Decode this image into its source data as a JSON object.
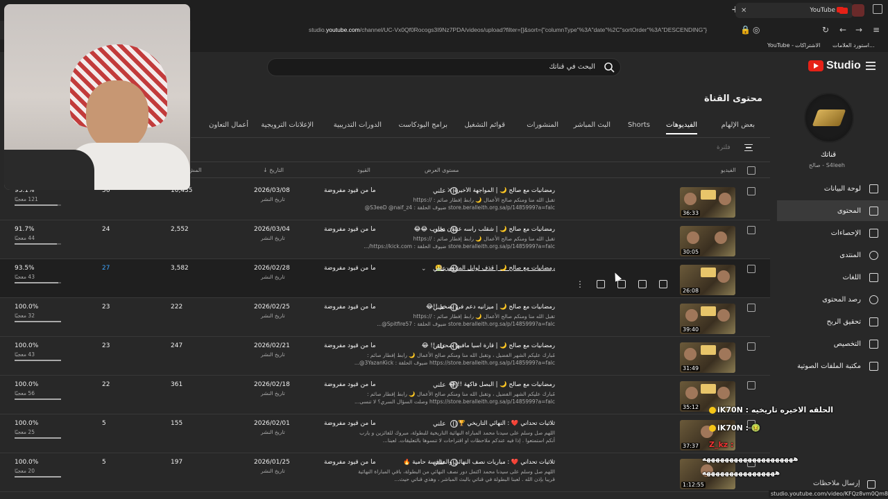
{
  "browser": {
    "tab_title": "YouTube",
    "url_prefix": "studio.",
    "url_domain": "youtube.com",
    "url_rest": "/channel/UC-Vx0Qf0Rocogs3I9Nz7PDA/videos/upload?filter=[]&sort={\"columnType\"%3A\"date\"%2C\"sortOrder\"%3A\"DESCENDING\"}",
    "bookmarks": [
      "استورد العلامات...",
      "الاشتراكات",
      "YouTube -"
    ]
  },
  "header": {
    "search_placeholder": "البحث في قناتك",
    "logo_text": "Studio"
  },
  "channel": {
    "name": "قناتك",
    "handle": "S4leeh - صالح"
  },
  "sidebar": {
    "items": [
      {
        "label": "لوحة البيانات",
        "icon": "dashboard-icon"
      },
      {
        "label": "المحتوى",
        "icon": "content-icon"
      },
      {
        "label": "الإحصاءات",
        "icon": "analytics-icon"
      },
      {
        "label": "المنتدى",
        "icon": "community-icon"
      },
      {
        "label": "اللغات",
        "icon": "subtitles-icon"
      },
      {
        "label": "رصد المحتوى",
        "icon": "copyright-icon"
      },
      {
        "label": "تحقيق الربح",
        "icon": "earn-icon"
      },
      {
        "label": "التخصيص",
        "icon": "customization-icon"
      },
      {
        "label": "مكتبة الملفات الصوتية",
        "icon": "audio-library-icon"
      }
    ],
    "feedback": "إرسال ملاحظات"
  },
  "main": {
    "title": "محتوى القناة",
    "tabs": [
      "بعض الإلهام",
      "الفيديوهات",
      "Shorts",
      "البث المباشر",
      "المنشورات",
      "قوائم التشغيل",
      "برامج البودكاست",
      "الدورات التدريبية",
      "الإعلانات الترويجية",
      "أعمال التعاون"
    ],
    "filter_label": "فلترة",
    "columns": {
      "video": "الفيديو",
      "visibility": "مستوى العرض",
      "restrictions": "القيود",
      "date": "التاريخ",
      "views": "المش"
    },
    "rows": [
      {
        "title": "رمضانيات مع صالح 🌙 | المواجهة الأخيرة ⚔",
        "desc": "تقبل الله منا ومنكم صالح الأعمال 🌙 رابط إفطار صائم : https:// store.beralleith.org.sa/p/1485999?a=falc ضيوف الحلقة : S3eeD @naif_z4@",
        "duration": "36:33",
        "visibility": "علني",
        "restrictions": "ما من قيود مفروضة",
        "date": "2026/03/08",
        "date_label": "تاريخ النشر",
        "views": "10,435",
        "comments": "56",
        "like_pct": "93.1%",
        "likes": "121 معجبًا",
        "like_ratio": 0.931
      },
      {
        "title": "رمضانيات مع صالح 🌙 | شقلب راسه عشان يجاوب 😂😂",
        "desc": "تقبل الله منا ومنكم صالح الأعمال 🌙 رابط إفطار صائم : https:// store.beralleith.org.sa/p/1485999?a=falc ضيوف الحلقة : https://kick.com/...",
        "duration": "30:05",
        "visibility": "علني",
        "restrictions": "ما من قيود مفروضة",
        "date": "2026/03/04",
        "date_label": "تاريخ النشر",
        "views": "2,552",
        "comments": "24",
        "like_pct": "91.7%",
        "likes": "44 معجبًا",
        "like_ratio": 0.917
      },
      {
        "title": "رمضانيات مع صالح 🌙 | قذف لوابل المتابعين 🤮",
        "desc": "",
        "duration": "26:08",
        "visibility": "علني",
        "restrictions": "ما من قيود مفروضة",
        "date": "2026/02/28",
        "date_label": "تاريخ النشر",
        "views": "3,582",
        "comments": "27",
        "like_pct": "93.5%",
        "likes": "43 معجبًا",
        "like_ratio": 0.935
      },
      {
        "title": "رمضانيات مع صالح 🌙 | ميزانيه دعم في تضخم !!😂",
        "desc": "تقبل الله منا ومنكم صالح الأعمال 🌙 رابط إفطار صائم : https:// store.beralleith.org.sa/p/1485999?a=falc ضيوف الحلقة : Spitfire57@...",
        "duration": "39:40",
        "visibility": "علني",
        "restrictions": "ما من قيود مفروضة",
        "date": "2026/02/25",
        "date_label": "تاريخ النشر",
        "views": "222",
        "comments": "23",
        "like_pct": "100.0%",
        "likes": "32 معجبًا",
        "like_ratio": 1.0
      },
      {
        "title": "رمضانيات مع صالح 🌙 | قارة آسيا مافيها صحراء !! 😂",
        "desc": "مُبارك عليكم الشهر الفضيل ، وتقبل الله منا ومنكم صالح الأعمال 🌙 رابط إفطار صائم : https://store.beralleith.org.sa/p/1485999?a=falc ضيوف الحلقة : 3YazanKick@...",
        "duration": "31:49",
        "visibility": "علني",
        "restrictions": "ما من قيود مفروضة",
        "date": "2026/02/21",
        "date_label": "تاريخ النشر",
        "views": "247",
        "comments": "23",
        "like_pct": "100.0%",
        "likes": "43 معجبًا",
        "like_ratio": 1.0
      },
      {
        "title": "رمضانيات مع صالح 🌙 | البصل فاكهة !! 😂",
        "desc": "مُبارك عليكم الشهر الفضيل ، وتقبل الله منا ومنكم صالح الأعمال 🌙 رابط إفطار صائم : https://store.beralleith.org.sa/p/1485999?a=falc وصلت السؤال السري؟ لا تنسى...",
        "duration": "35:12",
        "visibility": "علني",
        "restrictions": "ما من قيود مفروضة",
        "date": "2026/02/18",
        "date_label": "تاريخ النشر",
        "views": "361",
        "comments": "22",
        "like_pct": "100.0%",
        "likes": "56 معجبًا",
        "like_ratio": 1.0
      },
      {
        "title": "ثلاثيات تحداني ❤️ : النهائي التاريخي 🏆",
        "desc": "اللهم صل وسلم على سيدنا محمد المباراة النهائية التاريخية للبطولة، مبروك للفائزين و يارب أنكم استمتعوا . إذا فيه عندكم ملاحظات او اقتراحات لا تنسوها بالتعليقات. لعبنا...",
        "duration": "37:37",
        "visibility": "علني",
        "restrictions": "ما من قيود مفروضة",
        "date": "2026/02/01",
        "date_label": "تاريخ النشر",
        "views": "155",
        "comments": "5",
        "like_pct": "100.0%",
        "likes": "25 معجبًا",
        "like_ratio": 1.0
      },
      {
        "title": "ثلاثيات تحداني ❤️ : مباريات نصف النهائي والمنافسة حامية 🔥",
        "desc": "اللهم صل وسلم على سيدنا محمد اكتمل دور نصف النهائي من البطولة، باقي المباراة النهائية قريبا بإذن الله . لعبنا البطولة في قناتي بالبث المباشر ، وهذي قناتي حيث...",
        "duration": "1:12:55",
        "visibility": "علني",
        "restrictions": "ما من قيود مفروضة",
        "date": "2026/01/25",
        "date_label": "تاريخ النشر",
        "views": "197",
        "comments": "5",
        "like_pct": "100.0%",
        "likes": "20 معجبًا",
        "like_ratio": 1.0
      }
    ]
  },
  "chat": {
    "lines": [
      {
        "user": "iK70N :",
        "message": "الحلقه الاخيره تاريخيه"
      },
      {
        "user": "iK70N :",
        "message": "🤢"
      },
      {
        "user": "Z_kz :",
        "message": ""
      },
      {
        "user": "",
        "message": "ههههههههههههههههههههه"
      },
      {
        "user": "",
        "message": "ههههههههههههههههه"
      }
    ]
  },
  "status_url": "studio.youtube.com/video/KFQz8vm0Qm8/edit",
  "colors": {
    "accent": "#3ea6ff",
    "brand": "#e62117",
    "background": "#282828"
  }
}
